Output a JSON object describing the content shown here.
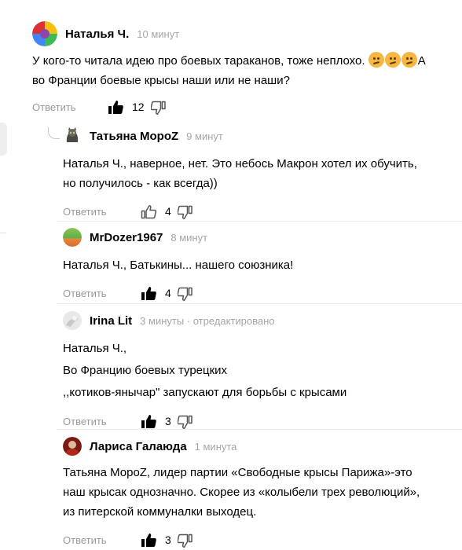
{
  "reply_label": "Ответить",
  "comments": [
    {
      "author": "Наталья Ч.",
      "time": "10 минут",
      "text_before_emoji": "У кого-то читала идею про боевых тараканов, тоже неплохо.",
      "emoji": [
        "confused-face-icon",
        "confused-face-icon",
        "confused-face-icon"
      ],
      "text_after_emoji": "А",
      "text_line2": "во Франции боевые крысы наши или не наши?",
      "likes": "12",
      "liked": true
    },
    {
      "author": "Татьяна МороZ",
      "time": "9 минут",
      "lines": [
        "Наталья Ч., наверное, нет. Это небось Макрон хотел их обучить,",
        "но получилось - как всегда))"
      ],
      "likes": "4",
      "liked": false
    },
    {
      "author": "MrDozer1967",
      "time": "8 минут",
      "lines": [
        "Наталья Ч., Батькины... нашего союзника!"
      ],
      "likes": "4",
      "liked": true
    },
    {
      "author": "Irina Lit",
      "time": "3 минуты · отредактировано",
      "lines": [
        "Наталья Ч.,",
        "Во Францию боевых турецких",
        ",,котиков-янычар\" запускают для борьбы с крысами"
      ],
      "likes": "3",
      "liked": true
    },
    {
      "author": "Лариса Галаюда",
      "time": "1 минута",
      "lines": [
        "Татьяна МороZ, лидер партии «Свободные крысы Парижа»-это",
        "наш крысак однозначно. Скорее из «колыбели трех революций»,",
        "из питерской коммуналки выходец."
      ],
      "likes": "3",
      "liked": true
    }
  ],
  "colors": {
    "meta": "#a6a6a6",
    "reply": "#9a9a9a",
    "emoji": "#f5b642"
  }
}
